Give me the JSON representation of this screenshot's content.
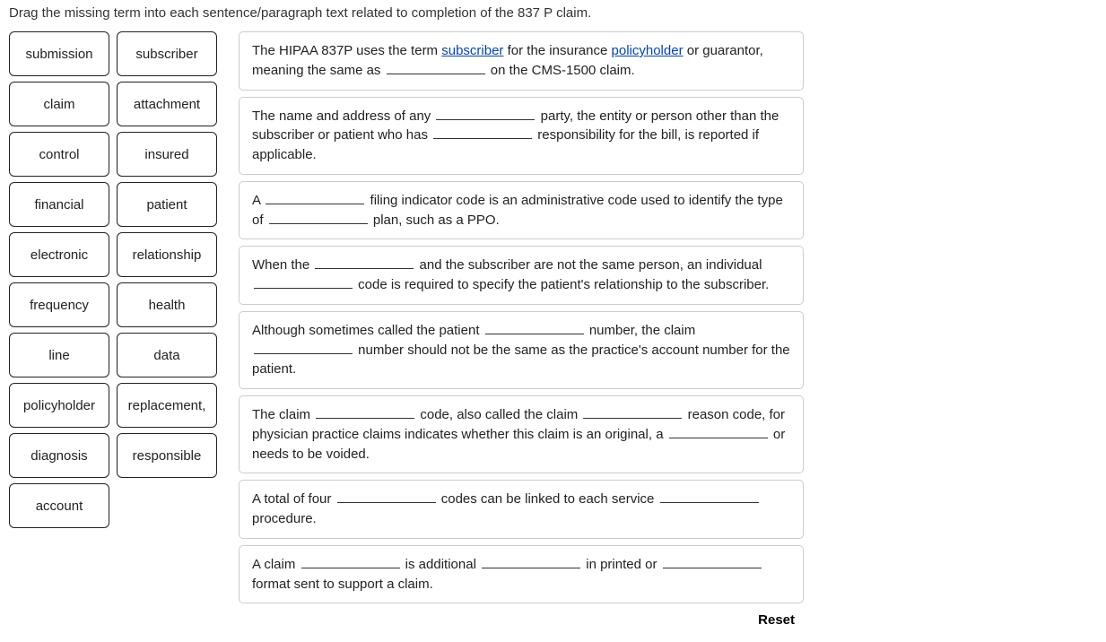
{
  "instruction": "Drag the missing term into each sentence/paragraph text related to completion of the 837 P claim.",
  "terms": [
    "submission",
    "subscriber",
    "claim",
    "attachment",
    "control",
    "insured",
    "financial",
    "patient",
    "electronic",
    "relationship",
    "frequency",
    "health",
    "line",
    "data",
    "policyholder",
    "replacement,",
    "diagnosis",
    "responsible",
    "account"
  ],
  "sentences": {
    "s1": {
      "p1": "The HIPAA 837P uses the term ",
      "link1": "subscriber",
      "p2": " for the insurance ",
      "link2": "policyholder",
      "p3": " or guarantor, meaning the same as ",
      "p4": " on the CMS-1500 claim."
    },
    "s2": {
      "p1": "The name and address of any ",
      "p2": " party, the entity or person other than the subscriber or patient who has ",
      "p3": " responsibility for the bill, is reported if applicable."
    },
    "s3": {
      "p1": "A ",
      "p2": " filing indicator code is an administrative code used to identify the type of ",
      "p3": " plan, such as a PPO."
    },
    "s4": {
      "p1": "When the ",
      "p2": " and the subscriber are not the same person, an individual ",
      "p3": " code is required to specify the patient's relationship to the subscriber."
    },
    "s5": {
      "p1": "Although sometimes called the patient ",
      "p2": " number, the claim ",
      "p3": " number should not be the same as the practice's account number for the patient."
    },
    "s6": {
      "p1": "The claim ",
      "p2": " code, also called the claim ",
      "p3": " reason code, for physician practice claims indicates whether this claim is an original, a ",
      "p4": " or needs to be voided."
    },
    "s7": {
      "p1": "A total of four ",
      "p2": " codes can be linked to each service ",
      "p3": " procedure."
    },
    "s8": {
      "p1": "A claim ",
      "p2": " is additional ",
      "p3": " in printed or ",
      "p4": " format sent to support a claim."
    }
  },
  "reset_label": "Reset"
}
